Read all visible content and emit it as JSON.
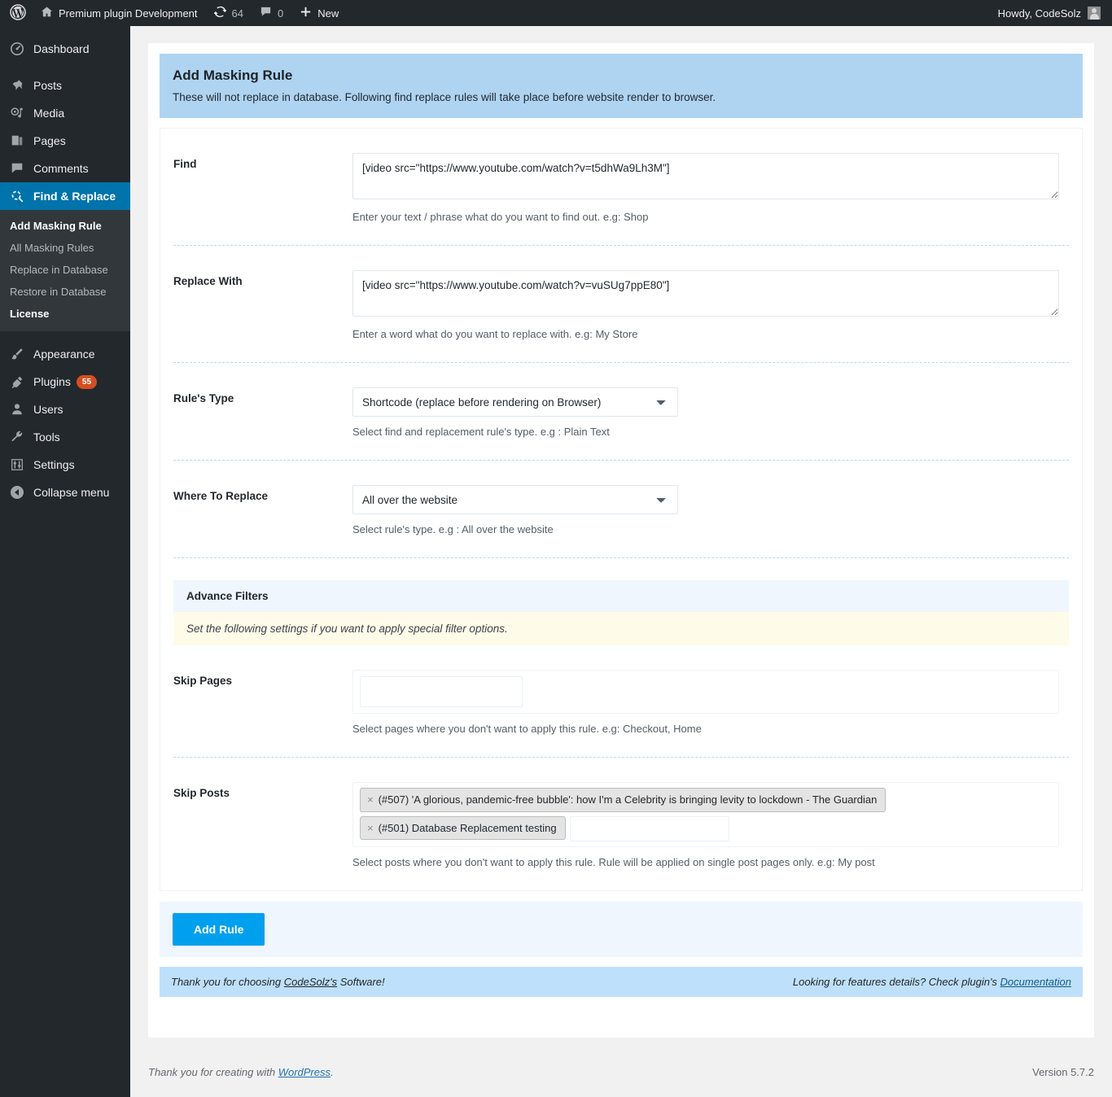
{
  "adminbar": {
    "site_name": "Premium plugin Development",
    "updates_count": "64",
    "comments_count": "0",
    "new_label": "New",
    "howdy": "Howdy, CodeSolz"
  },
  "sidebar": {
    "items": [
      {
        "label": "Dashboard",
        "icon": "dashboard-icon"
      },
      {
        "label": "Posts",
        "icon": "pin-icon"
      },
      {
        "label": "Media",
        "icon": "media-icon"
      },
      {
        "label": "Pages",
        "icon": "pages-icon"
      },
      {
        "label": "Comments",
        "icon": "comment-icon"
      },
      {
        "label": "Find & Replace",
        "icon": "search-replace-icon"
      },
      {
        "label": "Appearance",
        "icon": "brush-icon"
      },
      {
        "label": "Plugins",
        "icon": "plug-icon",
        "badge": "55"
      },
      {
        "label": "Users",
        "icon": "user-icon"
      },
      {
        "label": "Tools",
        "icon": "wrench-icon"
      },
      {
        "label": "Settings",
        "icon": "sliders-icon"
      },
      {
        "label": "Collapse menu",
        "icon": "collapse-icon"
      }
    ],
    "submenu": [
      {
        "label": "Add Masking Rule",
        "current": true
      },
      {
        "label": "All Masking Rules",
        "current": false
      },
      {
        "label": "Replace in Database",
        "current": false
      },
      {
        "label": "Restore in Database",
        "current": false
      },
      {
        "label": "License",
        "current": true
      }
    ]
  },
  "page": {
    "title": "Add Masking Rule",
    "description": "These will not replace in database. Following find replace rules will take place before website render to browser."
  },
  "form": {
    "find": {
      "label": "Find",
      "value": "[video src=\"https://www.youtube.com/watch?v=t5dhWa9Lh3M\"]",
      "help": "Enter your text / phrase what do you want to find out. e.g: Shop"
    },
    "replace_with": {
      "label": "Replace With",
      "value": "[video src=\"https://www.youtube.com/watch?v=vuSUg7ppE80\"]",
      "help": "Enter a word what do you want to replace with. e.g: My Store"
    },
    "rules_type": {
      "label": "Rule's Type",
      "value": "Shortcode (replace before rendering on Browser)",
      "help": "Select find and replacement rule's type. e.g : Plain Text",
      "options": [
        "Shortcode (replace before rendering on Browser)"
      ]
    },
    "where_to_replace": {
      "label": "Where To Replace",
      "value": "All over the website",
      "help": "Select rule's type. e.g : All over the website",
      "options": [
        "All over the website"
      ]
    },
    "advance_filters": {
      "heading": "Advance Filters",
      "note": "Set the following settings if you want to apply special filter options."
    },
    "skip_pages": {
      "label": "Skip Pages",
      "tokens": [],
      "input_value": "",
      "help": "Select pages where you don't want to apply this rule. e.g: Checkout, Home"
    },
    "skip_posts": {
      "label": "Skip Posts",
      "tokens": [
        "(#507) 'A glorious, pandemic-free bubble': how I'm a Celebrity is bringing levity to lockdown - The Guardian",
        "(#501) Database Replacement testing"
      ],
      "remove_glyph": "×",
      "input_value": "",
      "help": "Select posts where you don't want to apply this rule. Rule will be applied on single post pages only. e.g: My post"
    },
    "submit_label": "Add Rule"
  },
  "plugin_footer": {
    "thanks_prefix": "Thank you for choosing ",
    "thanks_link": "CodeSolz's",
    "thanks_suffix": " Software!",
    "docs_prefix": "Looking for features details? Check plugin's ",
    "docs_link": "Documentation"
  },
  "wp_footer": {
    "thanks_prefix": "Thank you for creating with ",
    "thanks_link": "WordPress",
    "thanks_suffix": ".",
    "version": "Version 5.7.2"
  },
  "colors": {
    "admin_bar": "#23282d",
    "menu_current": "#0073aa",
    "banner": "#aed4f2",
    "primary_button": "#00a0ee",
    "badge": "#d54e21"
  }
}
